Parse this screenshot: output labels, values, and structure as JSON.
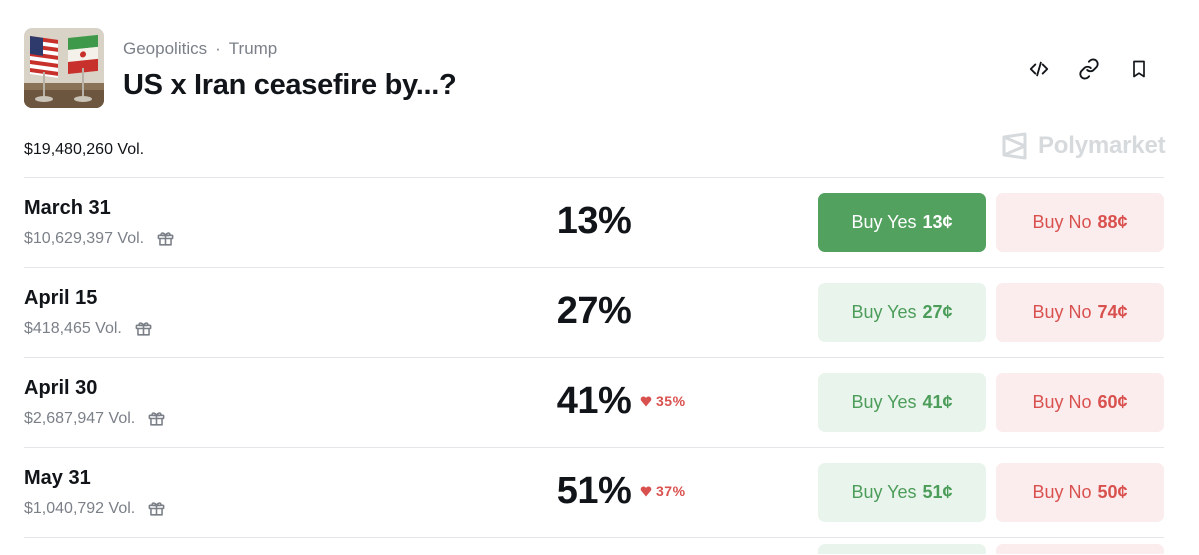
{
  "market": {
    "breadcrumb": [
      "Geopolitics",
      "Trump"
    ],
    "breadcrumb_separator": "·",
    "title": "US x Iran ceasefire by...?",
    "total_volume": "$19,480,260 Vol.",
    "brand": "Polymarket",
    "thumbnail_icon": "us-iran-flags-image"
  },
  "actions": [
    {
      "name": "embed-code-icon"
    },
    {
      "name": "link-icon"
    },
    {
      "name": "bookmark-icon"
    }
  ],
  "colors": {
    "yes_active_bg": "#52a15f",
    "yes_bg": "#e9f5ec",
    "yes_text": "#4c9c5a",
    "no_bg": "#fbeced",
    "no_text": "#d9514f",
    "change_down": "#d9514f",
    "brand_gray": "#d7dadd"
  },
  "outcomes": [
    {
      "date": "March 31",
      "volume": "$10,629,397 Vol.",
      "percent": "13%",
      "change": "",
      "yes_label": "Buy Yes",
      "yes_price": "13¢",
      "no_label": "Buy No",
      "no_price": "88¢",
      "yes_active": true
    },
    {
      "date": "April 15",
      "volume": "$418,465 Vol.",
      "percent": "27%",
      "change": "",
      "yes_label": "Buy Yes",
      "yes_price": "27¢",
      "no_label": "Buy No",
      "no_price": "74¢",
      "yes_active": false
    },
    {
      "date": "April 30",
      "volume": "$2,687,947 Vol.",
      "percent": "41%",
      "change": "35%",
      "yes_label": "Buy Yes",
      "yes_price": "41¢",
      "no_label": "Buy No",
      "no_price": "60¢",
      "yes_active": false
    },
    {
      "date": "May 31",
      "volume": "$1,040,792 Vol.",
      "percent": "51%",
      "change": "37%",
      "yes_label": "Buy Yes",
      "yes_price": "51¢",
      "no_label": "Buy No",
      "no_price": "50¢",
      "yes_active": false
    }
  ]
}
